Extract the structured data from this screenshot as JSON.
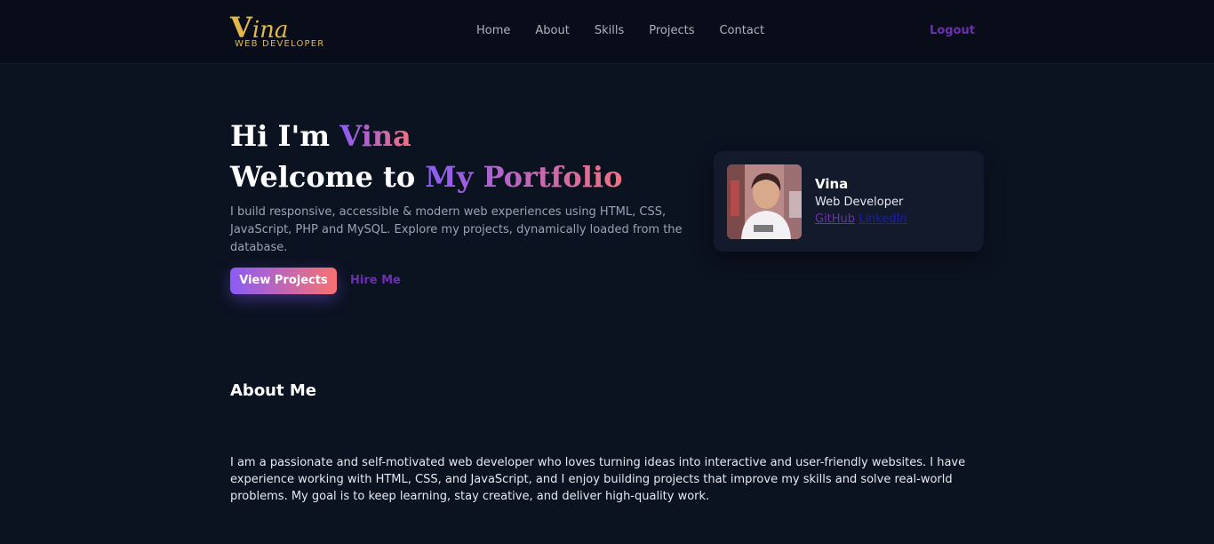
{
  "brand": {
    "initial": "V",
    "rest": "ina",
    "tagline": "WEB DEVELOPER",
    "color": "#e3b84a"
  },
  "nav": {
    "items": [
      {
        "label": "Home"
      },
      {
        "label": "About"
      },
      {
        "label": "Skills"
      },
      {
        "label": "Projects"
      },
      {
        "label": "Contact"
      }
    ],
    "logout_label": "Logout"
  },
  "hero": {
    "line1_prefix": "Hi I'm ",
    "line1_name": "Vina",
    "line2_prefix": "Welcome to ",
    "line2_highlight": "My Portfolio",
    "description": "I build responsive, accessible & modern web experiences using HTML, CSS, JavaScript, PHP and MySQL. Explore my projects, dynamically loaded from the database.",
    "primary_button": "View Projects",
    "secondary_button": "Hire Me",
    "gradient": [
      "#8a5cf6",
      "#f0727f"
    ]
  },
  "profile_card": {
    "name": "Vina",
    "role": "Web Developer",
    "github_label": "GitHub",
    "linkedin_label": "LinkedIn",
    "avatar_icon": "profile-photo"
  },
  "about": {
    "title": "About Me",
    "text": "I am a passionate and self-motivated web developer who loves turning ideas into interactive and user-friendly websites. I have experience working with HTML, CSS, and JavaScript, and I enjoy building projects that improve my skills and solve real-world problems. My goal is to keep learning, stay creative, and deliver high-quality work."
  },
  "colors": {
    "background": "#0b1220",
    "accent_purple": "#6b2fb0",
    "card": "#121a2b"
  }
}
